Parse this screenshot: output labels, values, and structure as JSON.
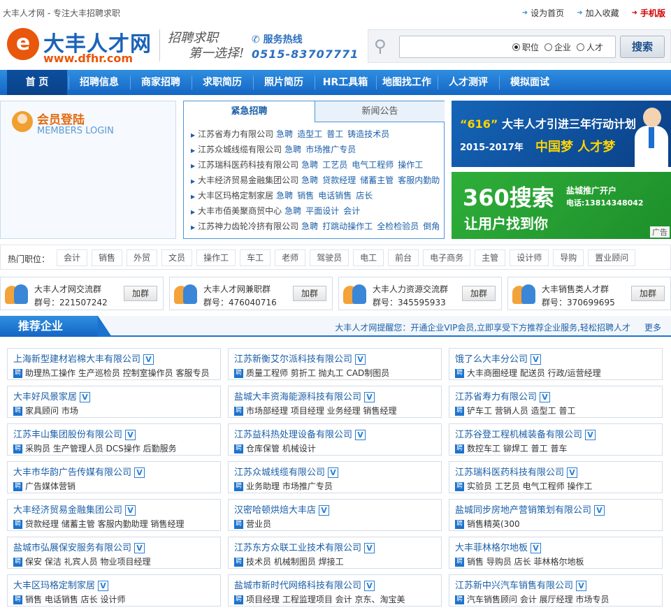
{
  "topbar": {
    "tagline": "大丰人才网 - 专注大丰招聘求职",
    "links": [
      "设为首页",
      "加入收藏",
      "手机版"
    ]
  },
  "header": {
    "logo_char": "e",
    "logo_name": "大丰人才网",
    "logo_url": "www.dfhr.com",
    "slogan_line1": "招聘求职",
    "slogan_line2": "第一选择!",
    "hotline_label": "服务热线",
    "hotline_number": "0515-83707771",
    "search": {
      "options": [
        "职位",
        "企业",
        "人才"
      ],
      "selected": "职位",
      "button": "搜索"
    }
  },
  "nav": [
    "首 页",
    "招聘信息",
    "商家招聘",
    "求职简历",
    "照片简历",
    "HR工具箱",
    "地图找工作",
    "人才测评",
    "模拟面试"
  ],
  "login": {
    "title": "会员登陆",
    "subtitle": "MEMBERS LOGIN"
  },
  "tabs": {
    "active": "紧急招聘",
    "inactive": "新闻公告"
  },
  "urgent": [
    {
      "company": "江苏省寿力有限公司",
      "tag": "急聘",
      "jobs": [
        "造型工",
        "普工",
        "铸造技术员"
      ]
    },
    {
      "company": "江苏众城线缆有限公司",
      "tag": "急聘",
      "jobs": [
        "市场推广专员"
      ]
    },
    {
      "company": "江苏瑞科医药科技有限公司",
      "tag": "急聘",
      "jobs": [
        "工艺员",
        "电气工程师",
        "操作工"
      ]
    },
    {
      "company": "大丰经济贸易金融集团公司",
      "tag": "急聘",
      "jobs": [
        "贷款经理",
        "储蓄主管",
        "客服内勤助"
      ]
    },
    {
      "company": "大丰区玛格定制家居",
      "tag": "急聘",
      "jobs": [
        "销售",
        "电话销售",
        "店长"
      ]
    },
    {
      "company": "大丰市佰美聚商贸中心",
      "tag": "急聘",
      "jobs": [
        "平面设计",
        "会计"
      ]
    },
    {
      "company": "江苏神力齿轮冷挤有限公司",
      "tag": "急聘",
      "jobs": [
        "打跳动操作工",
        "全检检验员",
        "倒角"
      ]
    }
  ],
  "banner1": {
    "num": "“616”",
    "line1": "大丰人才引进三年行动计划",
    "years": "2015-2017年",
    "dream": "中国梦 人才梦"
  },
  "banner2": {
    "big": "360搜索",
    "line1": "盐城推广开户",
    "line2": "电话:13814348042",
    "slogan": "让用户找到你",
    "ad": "广告"
  },
  "hot": {
    "label": "热门职位：",
    "tags": [
      "会计",
      "销售",
      "外贸",
      "文员",
      "操作工",
      "车工",
      "老师",
      "驾驶员",
      "电工",
      "前台",
      "电子商务",
      "主管",
      "设计师",
      "导购",
      "置业顾问"
    ]
  },
  "qq_groups": [
    {
      "name": "大丰人才网交流群",
      "num": "群号：221507242",
      "btn": "加群"
    },
    {
      "name": "大丰人才网兼职群",
      "num": "群号：476040716",
      "btn": "加群"
    },
    {
      "name": "大丰人力资源交流群",
      "num": "群号：345595933",
      "btn": "加群"
    },
    {
      "name": "大丰销售类人才群",
      "num": "群号：370699695",
      "btn": "加群"
    }
  ],
  "recommended": {
    "title": "推荐企业",
    "note": "大丰人才网提醒您：开通企业VIP会员,立即享受下方推荐企业服务,轻松招聘人才",
    "more": "更多",
    "badge": "V",
    "pin": "聘",
    "companies": [
      {
        "name": "上海新型建材岩棉大丰有限公司",
        "jobs": "助理热工操作 生产巡检员 控制室操作员 客服专员"
      },
      {
        "name": "江苏新衡艾尔派科技有限公司",
        "jobs": "质量工程师 剪折工 抛丸工 CAD制图员"
      },
      {
        "name": "饿了么大丰分公司",
        "jobs": "大丰商圈经理 配送员 行政/运营经理"
      },
      {
        "name": "大丰好风景家居",
        "jobs": "家具顾问 市场"
      },
      {
        "name": "盐城大丰资海能源科技有限公司",
        "jobs": "市场部经理 项目经理 业务经理 销售经理"
      },
      {
        "name": "江苏省寿力有限公司",
        "jobs": "铲车工 营销人员 造型工 普工"
      },
      {
        "name": "江苏丰山集团股份有限公司",
        "jobs": "采购员 生产管理人员 DCS操作 后勤服务"
      },
      {
        "name": "江苏益科热处理设备有限公司",
        "jobs": "仓库保管 机械设计"
      },
      {
        "name": "江苏谷登工程机械装备有限公司",
        "jobs": "数控车工 铆焊工 普工 普车"
      },
      {
        "name": "大丰市华韵广告传媒有限公司",
        "jobs": "广告媒体营销"
      },
      {
        "name": "江苏众城线缆有限公司",
        "jobs": "业务助理 市场推广专员"
      },
      {
        "name": "江苏瑞科医药科技有限公司",
        "jobs": "实验员 工艺员 电气工程师 操作工"
      },
      {
        "name": "大丰经济贸易金融集团公司",
        "jobs": "贷款经理 储蓄主管 客服内勤助理 销售经理"
      },
      {
        "name": "汉密哈顿烘焙大丰店",
        "jobs": "营业员"
      },
      {
        "name": "盐城同步房地产营销策划有限公司",
        "jobs": "销售精英(300"
      },
      {
        "name": "盐城市弘展保安服务有限公司",
        "jobs": "保安 保洁 礼宾人员 物业项目经理"
      },
      {
        "name": "江苏东方众联工业技术有限公司",
        "jobs": "技术员 机械制图员 焊接工"
      },
      {
        "name": "大丰菲林格尔地板",
        "jobs": "销售 导购员 店长 菲林格尔地板"
      },
      {
        "name": "大丰区玛格定制家居",
        "jobs": "销售 电话销售 店长 设计师"
      },
      {
        "name": "盐城市新时代网络科技有限公司",
        "jobs": "项目经理 工程监理项目 会计 京东、淘宝美"
      },
      {
        "name": "江苏新中兴汽车销售有限公司",
        "jobs": "汽车销售顾问 会计 展厅经理 市场专员"
      }
    ]
  },
  "colors": {
    "brand_blue": "#1b63b8",
    "nav_blue": "#2f8ee0",
    "accent_orange": "#e8570c"
  }
}
